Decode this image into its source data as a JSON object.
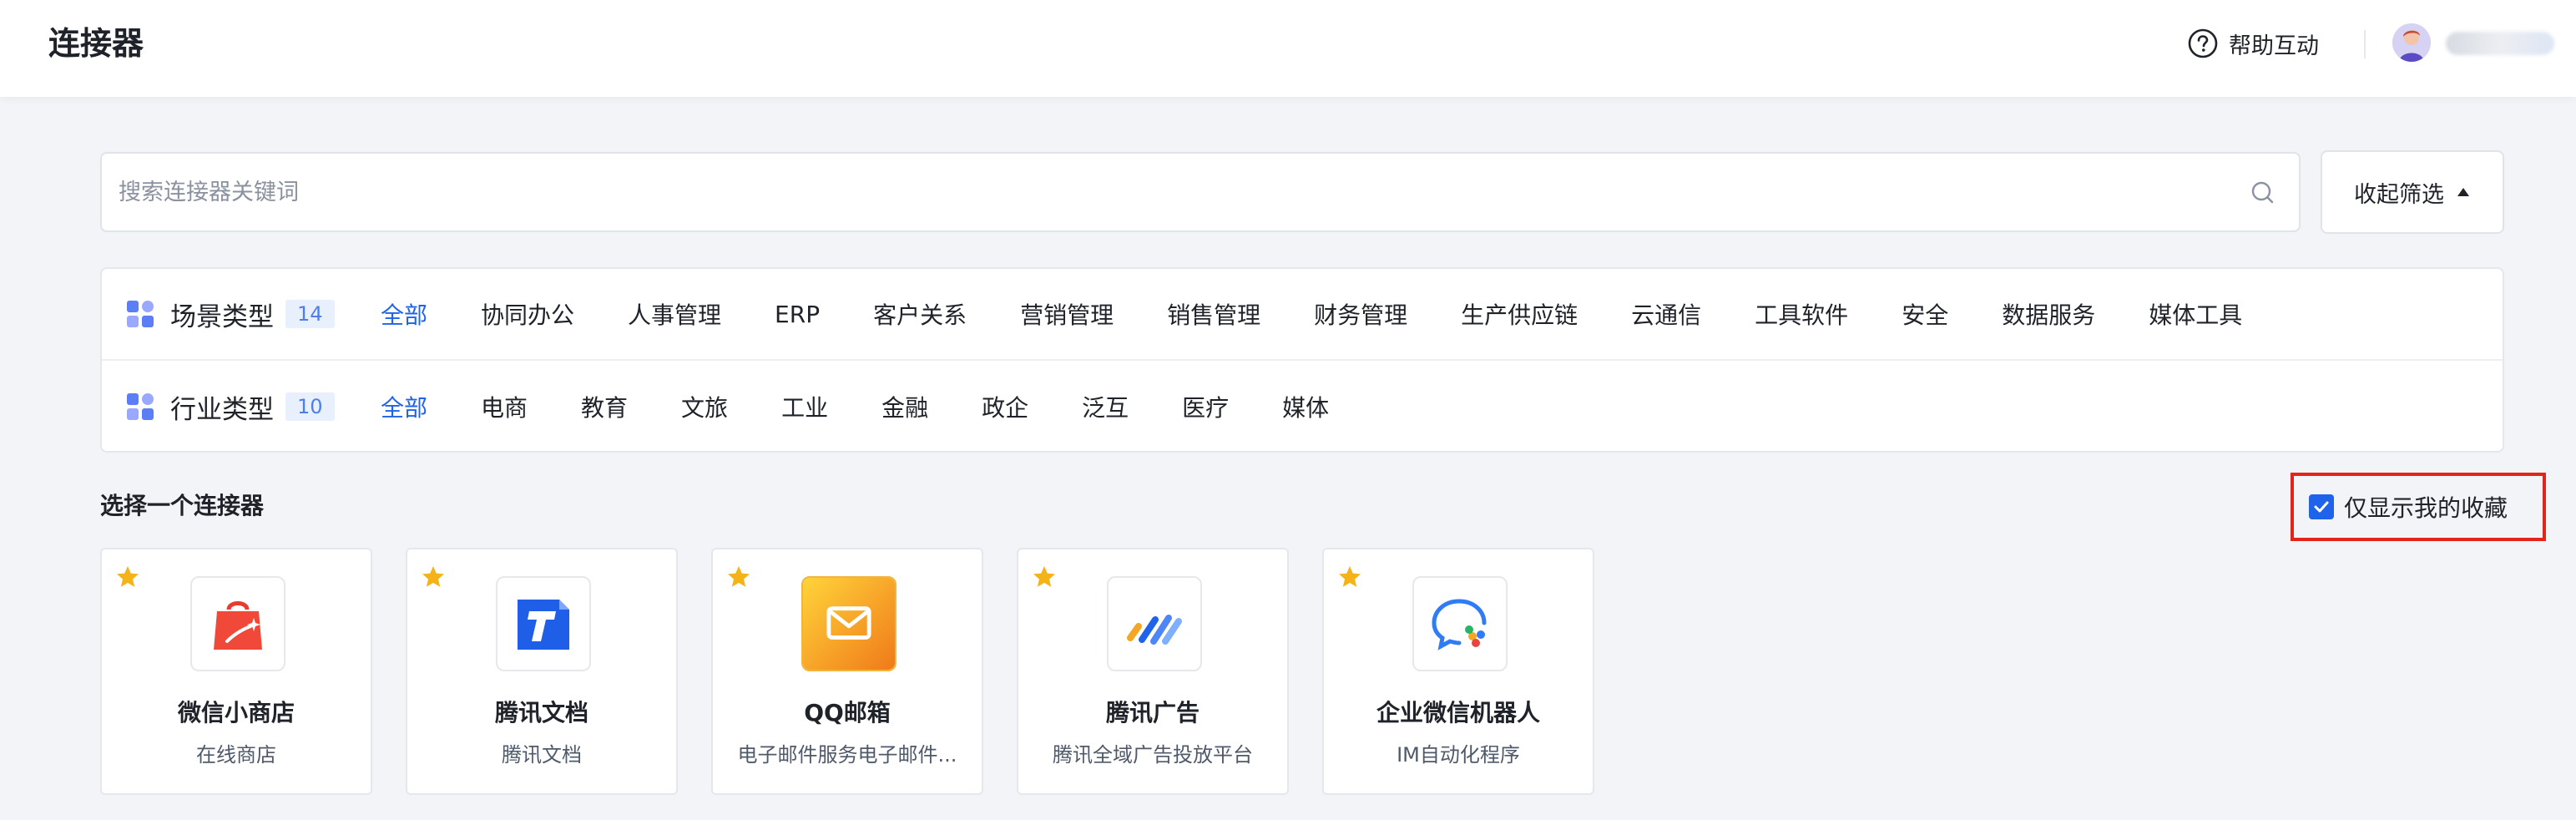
{
  "header": {
    "title": "连接器",
    "help_label": "帮助互动"
  },
  "search": {
    "placeholder": "搜索连接器关键词"
  },
  "filter_toggle": {
    "label": "收起筛选"
  },
  "filters": {
    "scene": {
      "title": "场景类型",
      "count": "14",
      "tags": [
        "全部",
        "协同办公",
        "人事管理",
        "ERP",
        "客户关系",
        "营销管理",
        "销售管理",
        "财务管理",
        "生产供应链",
        "云通信",
        "工具软件",
        "安全",
        "数据服务",
        "媒体工具"
      ]
    },
    "industry": {
      "title": "行业类型",
      "count": "10",
      "tags": [
        "全部",
        "电商",
        "教育",
        "文旅",
        "工业",
        "金融",
        "政企",
        "泛互",
        "医疗",
        "媒体"
      ]
    }
  },
  "section": {
    "title": "选择一个连接器",
    "fav_only_label": "仅显示我的收藏",
    "fav_only_checked": true
  },
  "cards": [
    {
      "name": "微信小商店",
      "desc": "在线商店",
      "icon": "shopping-bag-icon"
    },
    {
      "name": "腾讯文档",
      "desc": "腾讯文档",
      "icon": "tencent-docs-icon"
    },
    {
      "name": "QQ邮箱",
      "desc": "电子邮件服务电子邮件...",
      "icon": "mail-icon"
    },
    {
      "name": "腾讯广告",
      "desc": "腾讯全域广告投放平台",
      "icon": "tencent-ads-icon"
    },
    {
      "name": "企业微信机器人",
      "desc": "IM自动化程序",
      "icon": "wecom-bot-icon"
    }
  ],
  "colors": {
    "accent": "#1f63ea",
    "highlight_border": "#e2241a",
    "star": "#f5b31a",
    "background": "#f2f4f8"
  }
}
